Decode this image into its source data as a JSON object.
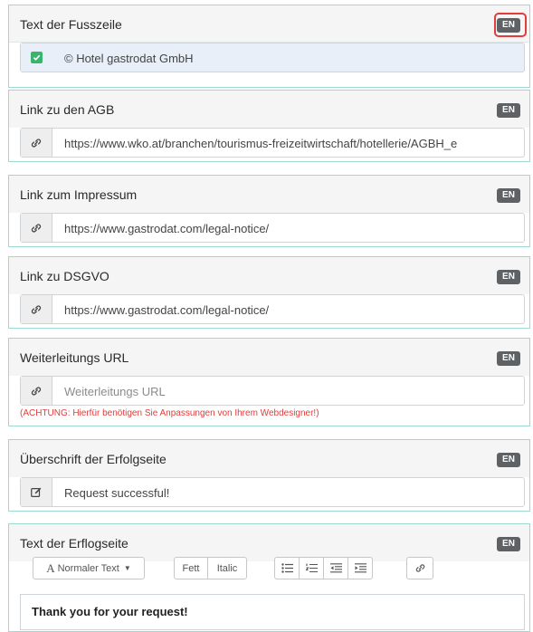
{
  "language_badge": "EN",
  "footer_text": {
    "title": "Text der Fusszeile",
    "value": "© Hotel gastrodat GmbH"
  },
  "agb_link": {
    "title": "Link zu den AGB",
    "value": "https://www.wko.at/branchen/tourismus-freizeitwirtschaft/hotellerie/AGBH_e"
  },
  "imprint_link": {
    "title": "Link zum Impressum",
    "value": "https://www.gastrodat.com/legal-notice/"
  },
  "dsgvo_link": {
    "title": "Link zu DSGVO",
    "value": "https://www.gastrodat.com/legal-notice/"
  },
  "redirect_url": {
    "title": "Weiterleitungs URL",
    "placeholder": "Weiterleitungs URL",
    "warning": "(ACHTUNG: Hierfür benötigen Sie Anpassungen von Ihrem Webdesigner!)"
  },
  "success_heading": {
    "title": "Überschrift der Erfolgseite",
    "value": "Request successful!"
  },
  "success_text": {
    "title": "Text der Erflogseite",
    "toolbar": {
      "format_label": "Normaler Text",
      "bold_label": "Fett",
      "italic_label": "Italic"
    },
    "content": "Thank you for your request!"
  },
  "colors": {
    "panel_border": "#9fd8d2",
    "badge": "#5e6265",
    "highlight": "#e23c3c",
    "check": "#3bb36f"
  }
}
